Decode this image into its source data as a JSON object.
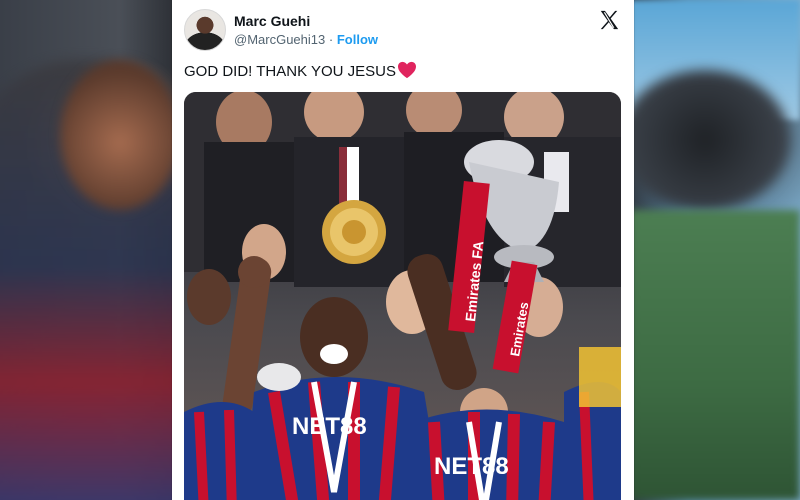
{
  "tweet": {
    "display_name": "Marc Guehi",
    "handle": "@MarcGuehi13",
    "separator": "·",
    "follow_label": "Follow",
    "text": "GOD DID! THANK YOU JESUS",
    "emoji_icon": "red-heart-icon",
    "platform_icon": "x-logo-icon"
  },
  "photo": {
    "jersey_text": "NET88",
    "ribbon_text": "Emirates FA",
    "ribbon_text_2": "Emirates"
  },
  "colors": {
    "follow": "#1d9bf0",
    "name": "#0f1419",
    "secondary": "#536471",
    "heart": "#e0245e"
  }
}
